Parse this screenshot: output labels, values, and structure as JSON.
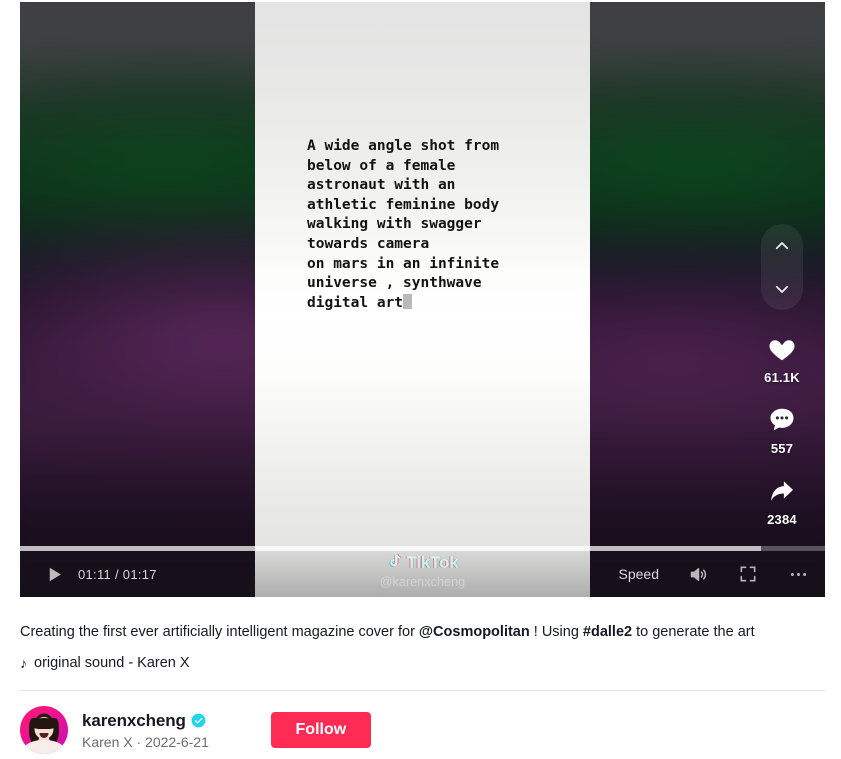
{
  "video": {
    "prompt_text": "A wide angle shot from\nbelow of a female\nastronaut with an\nathletic feminine body\nwalking with swagger\ntowards camera\non mars in an infinite\nuniverse , synthwave\ndigital art",
    "current_time": "01:11",
    "duration": "01:17",
    "timecode": "01:11 / 01:17",
    "progress_percent": 92,
    "play_icon": "play-icon",
    "speed_label": "Speed",
    "volume_icon": "volume-icon",
    "fullscreen_icon": "fullscreen-icon",
    "more_icon": "more-options-icon"
  },
  "watermark": {
    "brand": "TikTok",
    "handle": "@karenxcheng",
    "logo_icon": "tiktok-note-icon"
  },
  "rail": {
    "prev_icon": "chevron-up-icon",
    "next_icon": "chevron-down-icon",
    "actions": [
      {
        "icon": "heart-icon",
        "name": "like",
        "count": "61.1K"
      },
      {
        "icon": "comment-icon",
        "name": "comment",
        "count": "557"
      },
      {
        "icon": "share-icon",
        "name": "share",
        "count": "2384"
      }
    ]
  },
  "caption": {
    "part1": "Creating the first ever artificially intelligent magazine cover for ",
    "mention": "@Cosmopolitan",
    "part2": " ! Using ",
    "hashtag": "#dalle2",
    "part3": " to generate the art"
  },
  "music": {
    "note_icon": "music-note-icon",
    "label": "original sound - Karen X"
  },
  "author": {
    "avatar_icon": "user-avatar",
    "username": "karenxcheng",
    "verified_icon": "verified-badge-icon",
    "display_name": "Karen X",
    "separator": " · ",
    "date": "2022-6-21",
    "subtitle": "Karen X · 2022-6-21",
    "follow_label": "Follow"
  },
  "colors": {
    "accent_red": "#fe2c55",
    "verified_blue": "#20d5ec",
    "text_primary": "#161823",
    "text_secondary": "#6b6b72"
  }
}
